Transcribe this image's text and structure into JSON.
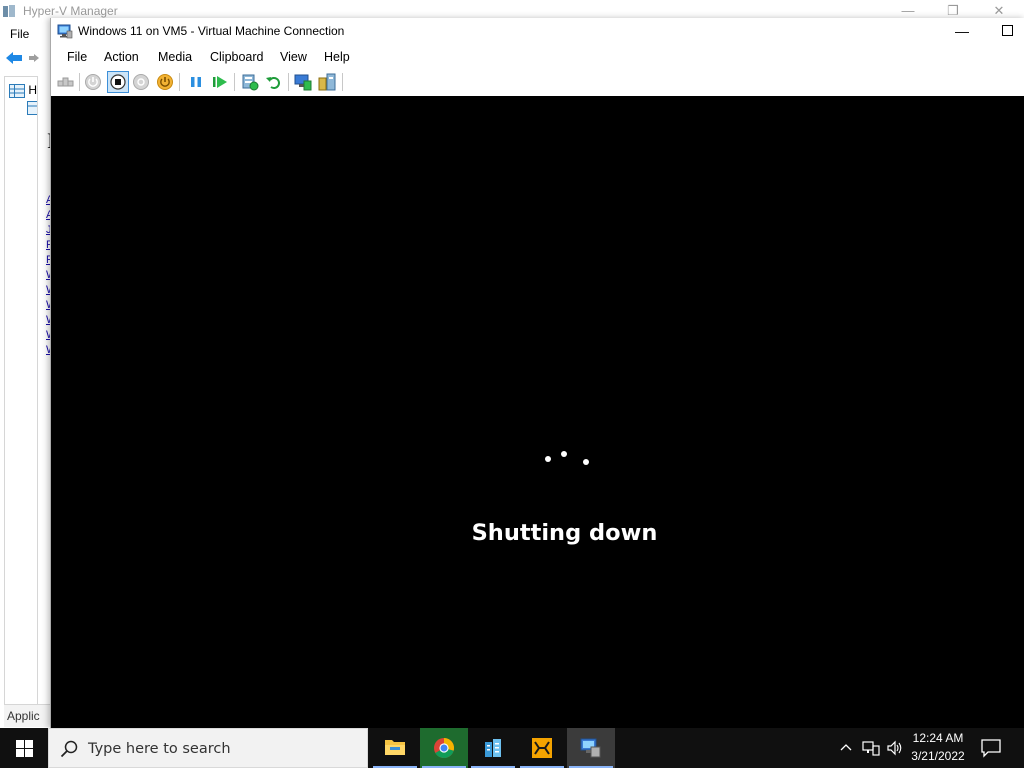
{
  "background_window": {
    "title": "Hyper-V Manager",
    "menu_file": "File",
    "tree_item": "H",
    "mid_letter": "I",
    "mid_links": [
      "A",
      "A",
      "J",
      "R",
      "R",
      "W",
      "W",
      "W",
      "W",
      "W",
      "W"
    ],
    "status_text": "Applic"
  },
  "vm_window": {
    "title": "Windows 11 on VM5 - Virtual Machine Connection",
    "menu": [
      "File",
      "Action",
      "Media",
      "Clipboard",
      "View",
      "Help"
    ],
    "toolbar_icons": [
      "ctrl-alt-del-icon",
      "start-icon",
      "turn-off-icon",
      "shut-down-icon",
      "save-icon",
      "pause-icon",
      "resume-icon",
      "checkpoint-icon",
      "revert-icon",
      "enhanced-session-icon",
      "share-icon"
    ],
    "screen": {
      "status_text": "Shutting down",
      "background_color": "#000000"
    }
  },
  "taskbar": {
    "search_placeholder": "Type here to search",
    "apps": [
      "File Explorer",
      "Google Chrome",
      "Server Manager",
      "VMware",
      "Hyper-V Manager"
    ],
    "time": "12:24 AM",
    "date": "3/21/2022"
  },
  "colors": {
    "taskbar": "#101010",
    "search_box": "#f2f2f2",
    "accent": "#0078d7"
  }
}
